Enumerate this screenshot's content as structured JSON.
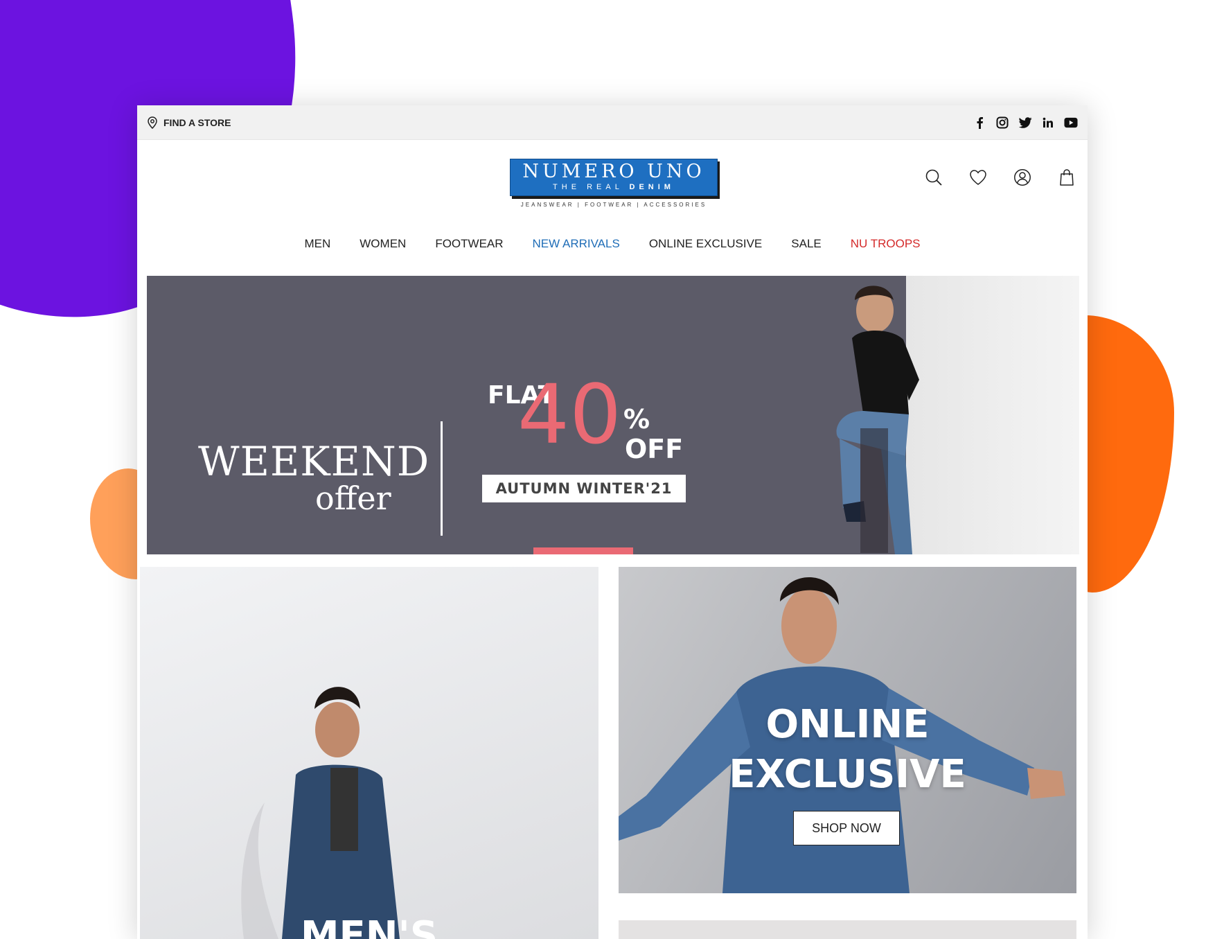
{
  "topbar": {
    "find_store": "FIND A STORE",
    "social_icons": [
      "facebook-icon",
      "instagram-icon",
      "twitter-icon",
      "linkedin-icon",
      "youtube-icon"
    ]
  },
  "logo": {
    "main": "NUMERO UNO",
    "sub_prefix": "THE REAL",
    "sub_bold": "DENIM",
    "tagline": "JEANSWEAR | FOOTWEAR | ACCESSORIES"
  },
  "header_icons": [
    "search-icon",
    "wishlist-heart-icon",
    "account-icon",
    "shopping-bag-icon"
  ],
  "nav": {
    "men": "MEN",
    "women": "WOMEN",
    "footwear": "FOOTWEAR",
    "new_arrivals": "NEW ARRIVALS",
    "online_exclusive": "ONLINE EXCLUSIVE",
    "sale": "SALE",
    "nu_troops": "NU TROOPS"
  },
  "banner": {
    "weekend": "WEEKEND",
    "offer": "offer",
    "flat": "FLAT",
    "number": "40",
    "percent": "%",
    "off": "OFF",
    "season": "AUTUMN WINTER'21"
  },
  "tiles": {
    "online_line1": "ONLINE",
    "online_line2": "EXCLUSIVE",
    "shop_now": "SHOP NOW",
    "mens": "MEN'S"
  },
  "colors": {
    "purple_blob": "#6c13e0",
    "orange_blob": "#ff6a0e",
    "peach_blob": "#ffa05a",
    "logo_blue": "#1e6fc1",
    "banner_bg": "#5c5b68",
    "banner_accent": "#ea6a74",
    "nav_blue": "#1f6db7",
    "nav_red": "#d42a2a"
  }
}
